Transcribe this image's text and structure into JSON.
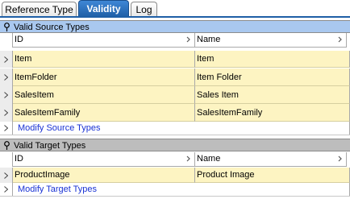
{
  "tabs": [
    {
      "label": "Reference Type",
      "active": false
    },
    {
      "label": "Validity",
      "active": true
    },
    {
      "label": "Log",
      "active": false
    }
  ],
  "source": {
    "title": "Valid Source Types",
    "header_color": "#a9c8ef",
    "columns": [
      "ID",
      "Name"
    ],
    "rows": [
      {
        "id": "Item",
        "name": "Item"
      },
      {
        "id": "ItemFolder",
        "name": "Item Folder"
      },
      {
        "id": "SalesItem",
        "name": "Sales Item"
      },
      {
        "id": "SalesItemFamily",
        "name": "SalesItemFamily"
      }
    ],
    "action": "Modify Source Types"
  },
  "target": {
    "title": "Valid Target Types",
    "header_color": "#bdbdbd",
    "columns": [
      "ID",
      "Name"
    ],
    "rows": [
      {
        "id": "ProductImage",
        "name": "Product Image"
      }
    ],
    "action": "Modify Target Types"
  },
  "colors": {
    "row_background": "#fdf4c2",
    "link": "#1a33d4",
    "active_tab": "#1f5fa6"
  },
  "icons": {
    "group_pin": "pushpin-icon",
    "row_selector": "triangle-right-icon",
    "column_chevron": "chevron-right-icon"
  }
}
